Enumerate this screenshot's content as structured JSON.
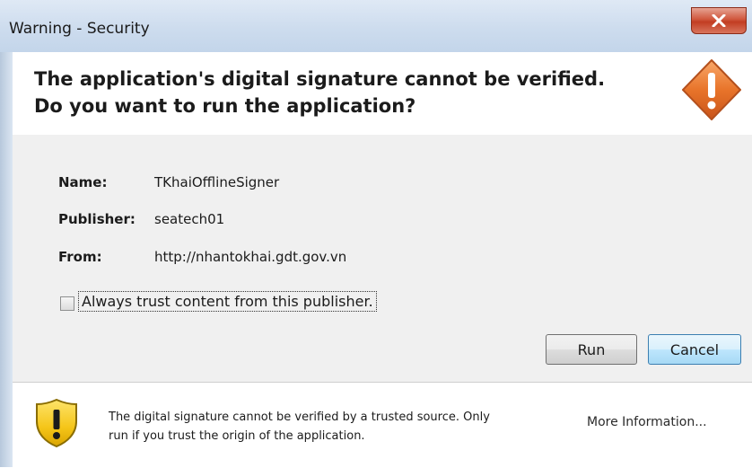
{
  "window": {
    "title": "Warning - Security"
  },
  "header": {
    "line1": "The application's digital signature cannot be verified.",
    "line2": "Do you want to run the application?"
  },
  "details": [
    {
      "label": "Name:",
      "value": "TKhaiOfflineSigner"
    },
    {
      "label": "Publisher:",
      "value": "seatech01"
    },
    {
      "label": "From:",
      "value": "http://nhantokhai.gdt.gov.vn"
    }
  ],
  "checkbox": {
    "label": "Always trust content from this publisher.",
    "checked": false
  },
  "buttons": {
    "run": "Run",
    "cancel": "Cancel"
  },
  "footer": {
    "line1": "The digital signature cannot be verified by a trusted source.  Only",
    "line2": "run if you trust the origin of the application.",
    "more_info": "More Information..."
  },
  "colors": {
    "warning_orange": "#e8742a",
    "shield_yellow": "#f5c518",
    "close_red": "#c94a30",
    "cancel_blue_border": "#3c7fb1"
  },
  "icons": {
    "close": "close-icon",
    "header_warning": "warning-diamond-icon",
    "footer_warning": "shield-warning-icon"
  }
}
